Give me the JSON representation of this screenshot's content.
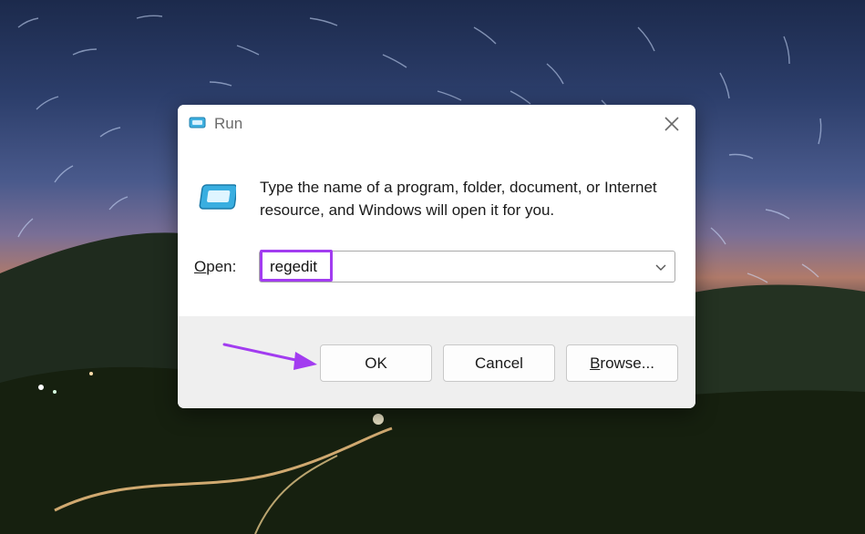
{
  "window": {
    "title": "Run",
    "close_icon": "close-icon",
    "app_icon": "run-icon"
  },
  "body": {
    "description": "Type the name of a program, folder, document, or Internet resource, and Windows will open it for you.",
    "open_label_underlined": "O",
    "open_label_rest": "pen:",
    "open_value": "regedit"
  },
  "buttons": {
    "ok": "OK",
    "cancel": "Cancel",
    "browse_underlined": "B",
    "browse_rest": "rowse..."
  },
  "annotation": {
    "highlight_color": "#a23cf0",
    "arrow_color": "#a23cf0"
  }
}
